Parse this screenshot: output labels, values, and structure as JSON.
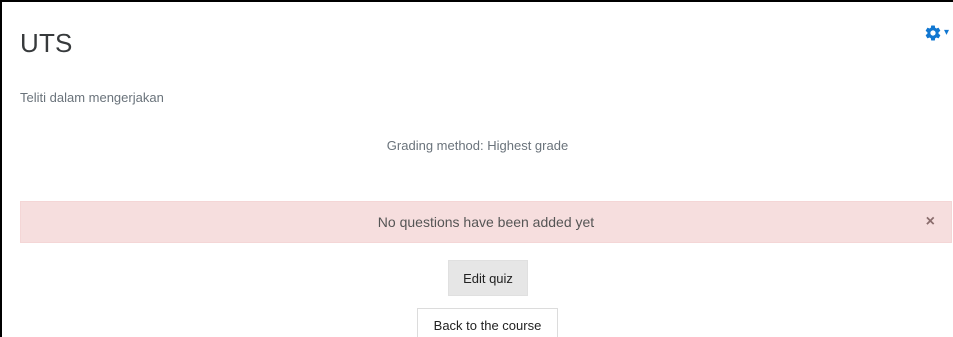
{
  "page": {
    "title": "UTS",
    "intro": "Teliti dalam mengerjakan",
    "grading_method": "Grading method: Highest grade"
  },
  "alert": {
    "message": "No questions have been added yet",
    "close_glyph": "×"
  },
  "actions": {
    "edit_quiz_label": "Edit quiz",
    "back_label": "Back to the course"
  },
  "settings": {
    "icon": "gear-icon",
    "caret": "▾",
    "accent_color": "#1177d1"
  }
}
